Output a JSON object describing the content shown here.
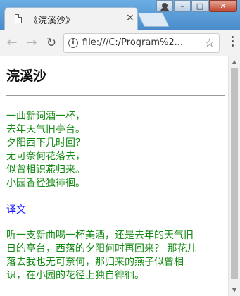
{
  "browser": {
    "tab_title": "《浣溪沙》",
    "tab_close": "×",
    "url": "file:///C:/Program%2...",
    "window_controls": {
      "minimize": "–",
      "maximize": "□",
      "close": "✕"
    },
    "icons": {
      "back": "arrow-left-icon",
      "forward": "arrow-right-icon",
      "reload": "reload-icon",
      "info": "info-icon",
      "bookmark": "star-icon",
      "menu": "kebab-menu-icon"
    }
  },
  "page": {
    "title": "浣溪沙",
    "poem_lines": [
      "一曲新词酒一杯，",
      "去年天气旧亭台。",
      "夕阳西下几时回？",
      "无可奈何花落去，",
      "似曾相识燕归来。",
      "小园香径独徘徊。"
    ],
    "translation_link": "译文",
    "translation_lines": [
      "听一支新曲喝一杯美酒，还是去年的天气旧",
      "日的亭台，西落的夕阳何时再回来？ 那花儿",
      "落去我也无可奈何，那归来的燕子似曾相",
      "识，在小园的花径上独自徘徊。"
    ]
  },
  "colors": {
    "poem_text": "#138a13",
    "link": "#1a1aff",
    "title_bar": "#5a9fd6"
  }
}
